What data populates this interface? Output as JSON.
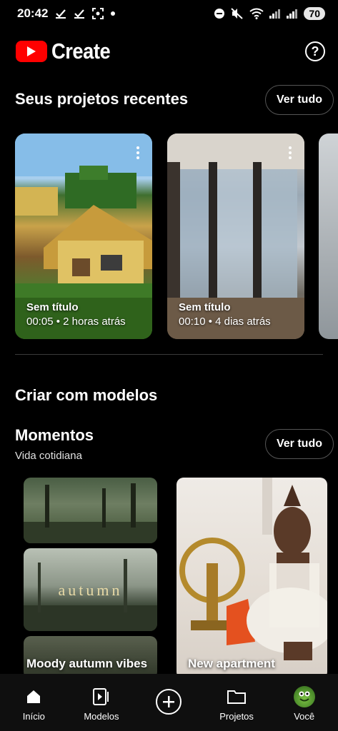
{
  "status_bar": {
    "time": "20:42",
    "battery": "70"
  },
  "header": {
    "app_name": "Create",
    "help_label": "?"
  },
  "recent": {
    "title": "Seus projetos recentes",
    "see_all": "Ver tudo",
    "projects": [
      {
        "title": "Sem título",
        "meta": "00:05 • 2 horas atrás"
      },
      {
        "title": "Sem título",
        "meta": "00:10 • 4 dias atrás"
      }
    ]
  },
  "templates": {
    "title": "Criar com modelos",
    "category": {
      "title": "Momentos",
      "subtitle": "Vida cotidiana",
      "see_all": "Ver tudo",
      "items": [
        {
          "label": "Moody autumn vibes",
          "overlay_text": "autumn"
        },
        {
          "label": "New apartment"
        }
      ]
    }
  },
  "bottom_nav": {
    "items": [
      {
        "label": "Início"
      },
      {
        "label": "Modelos"
      },
      {
        "label": ""
      },
      {
        "label": "Projetos"
      },
      {
        "label": "Você"
      }
    ]
  },
  "colors": {
    "brand_red": "#ff0000",
    "background": "#000000",
    "nav_background": "#0f0f0f"
  }
}
